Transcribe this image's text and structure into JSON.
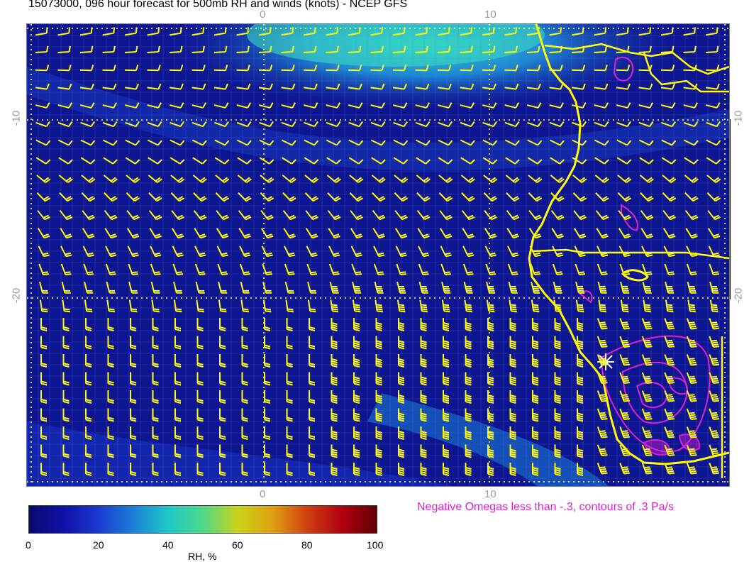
{
  "header": {
    "title": "15073000, 096 hour forecast for 500mb RH and winds (knots) - NCEP GFS"
  },
  "map": {
    "lon_ticks": [
      "0",
      "10"
    ],
    "lat_ticks": [
      "-10",
      "-20"
    ],
    "colors": {
      "ocean_base": "#10189a",
      "coast": "#ffff00",
      "barb": "#ffff00",
      "omega": "#e020d0",
      "grid": "#6a78e0",
      "graticule": "#ffff66"
    },
    "symbols": [
      "wind-barb-icon",
      "omega-contour-icon",
      "asterisk-marker-icon"
    ]
  },
  "colorbar": {
    "label": "RH, %",
    "ticks": [
      "0",
      "20",
      "40",
      "60",
      "80",
      "100"
    ],
    "range": [
      0,
      100
    ],
    "colors": [
      "#0a0a6e",
      "#1a3ad0",
      "#1fc8c8",
      "#c8d41a",
      "#d04010",
      "#600008"
    ]
  },
  "legend": {
    "omega_note": "Negative Omegas less than -.3, contours of .3 Pa/s"
  }
}
